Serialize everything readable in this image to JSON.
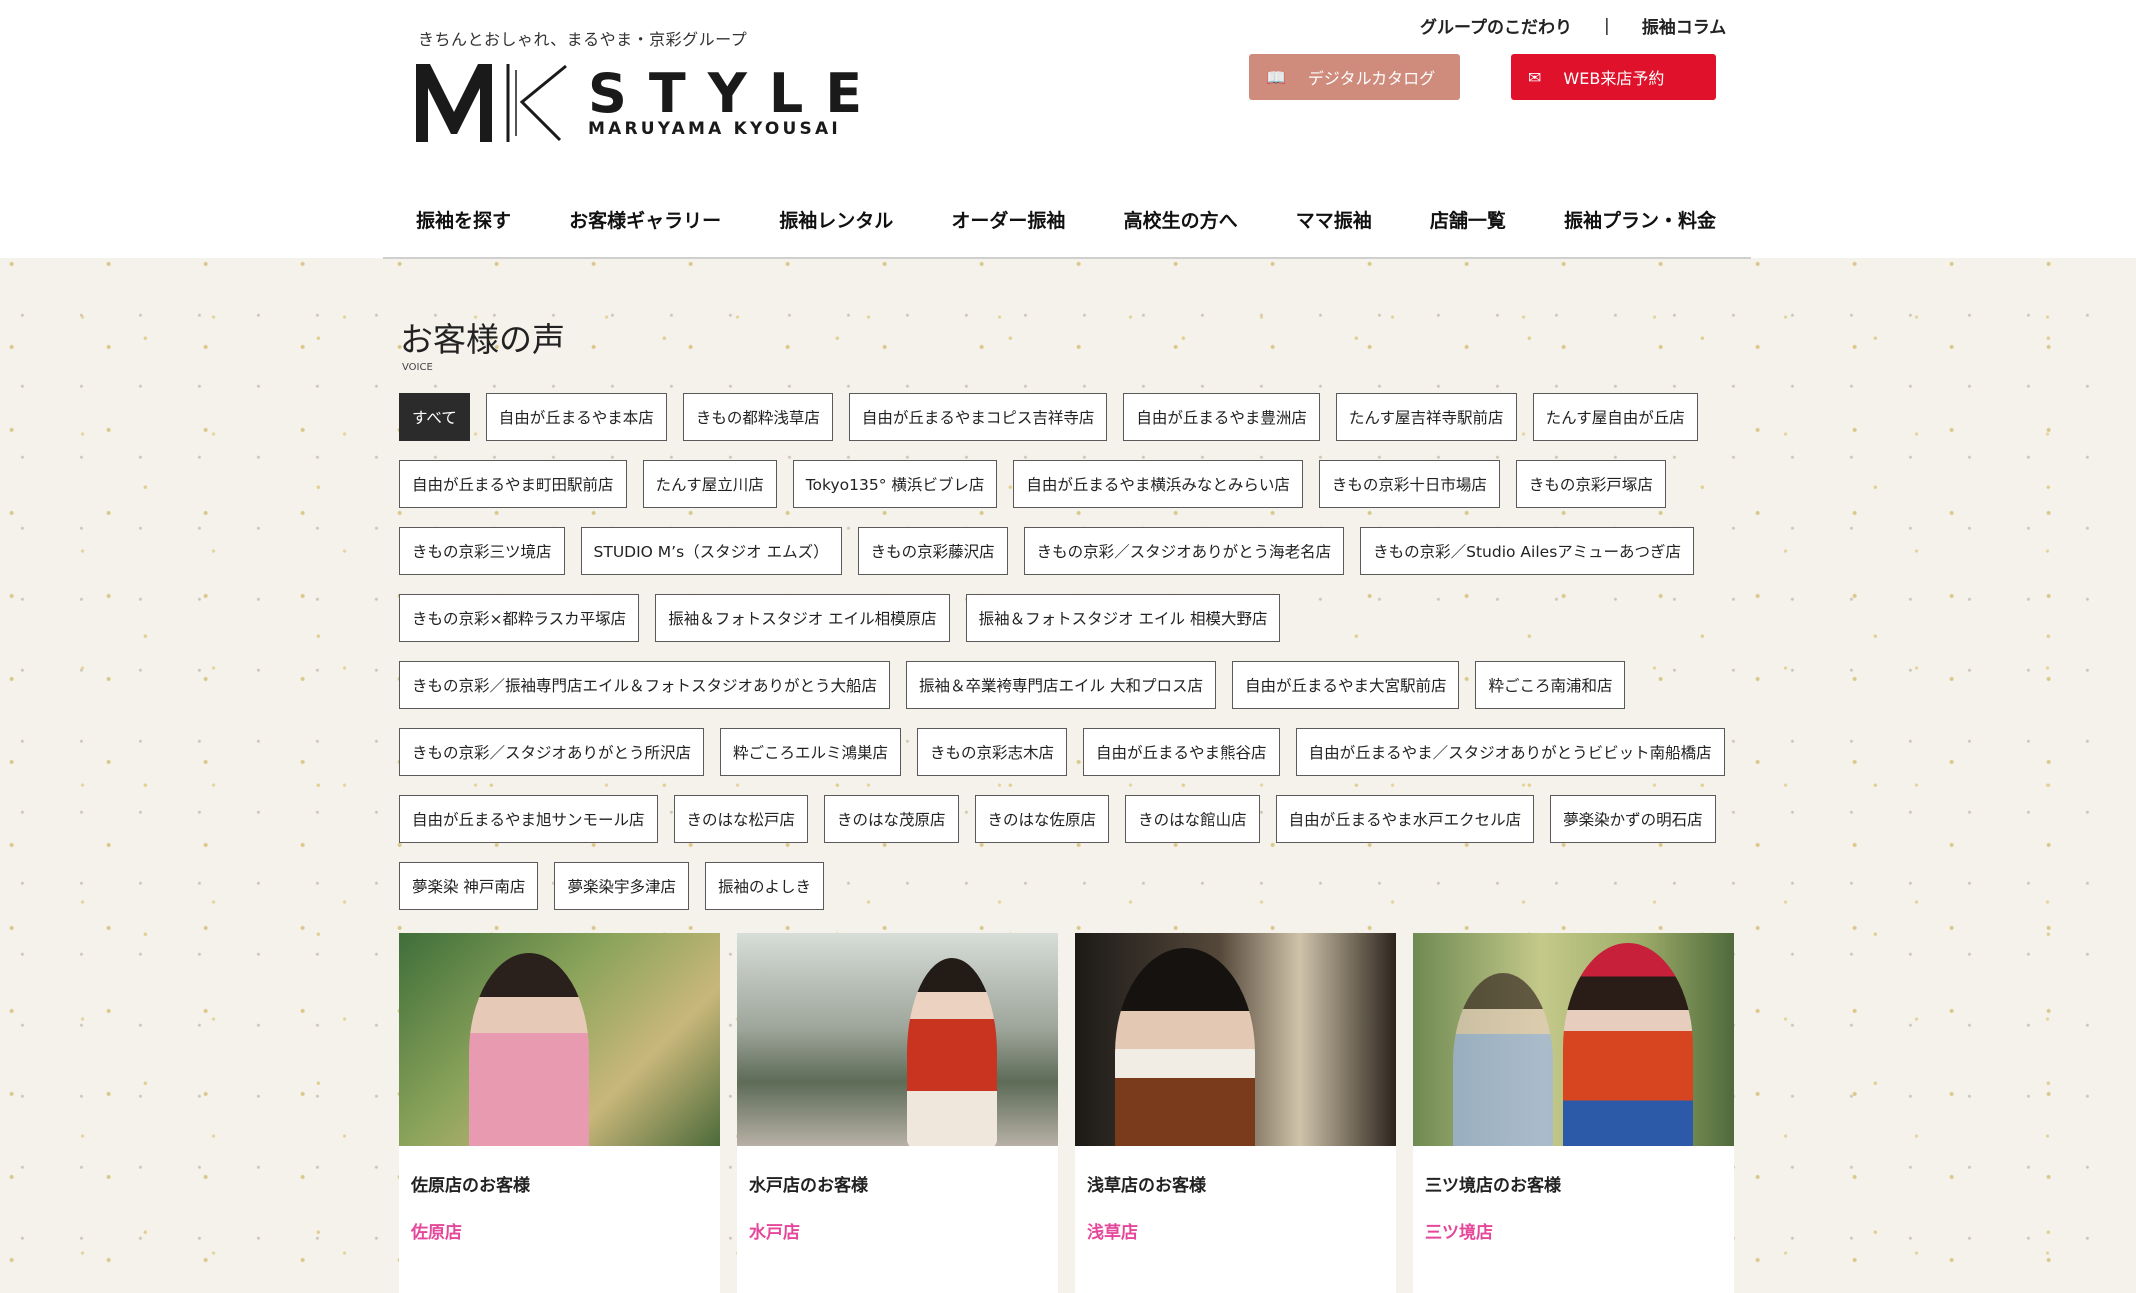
{
  "header": {
    "tagline": "きちんとおしゃれ、まるやま・京彩グループ",
    "logo_main": "STYLE",
    "logo_sub": "MARUYAMA KYOUSAI",
    "top_links": [
      "グループのこだわり",
      "振袖コラム"
    ],
    "top_link_separator": "|",
    "catalog_button": "デジタルカタログ",
    "reserve_button": "WEB来店予約",
    "catalog_color": "#cf8c7d",
    "reserve_color": "#e0112a"
  },
  "nav": [
    "振袖を探す",
    "お客様ギャラリー",
    "振袖レンタル",
    "オーダー振袖",
    "高校生の方へ",
    "ママ振袖",
    "店舗一覧",
    "振袖プラン・料金"
  ],
  "section": {
    "title": "お客様の声",
    "subtitle": "VOICE"
  },
  "tags": [
    "すべて",
    "自由が丘まるやま本店",
    "きもの都粋浅草店",
    "自由が丘まるやまコピス吉祥寺店",
    "自由が丘まるやま豊洲店",
    "たんす屋吉祥寺駅前店",
    "たんす屋自由が丘店",
    "自由が丘まるやま町田駅前店",
    "たんす屋立川店",
    "Tokyo135° 横浜ビブレ店",
    "自由が丘まるやま横浜みなとみらい店",
    "きもの京彩十日市場店",
    "きもの京彩戸塚店",
    "きもの京彩三ツ境店",
    "STUDIO M’s（スタジオ エムズ）",
    "きもの京彩藤沢店",
    "きもの京彩／スタジオありがとう海老名店",
    "きもの京彩／Studio Ailesアミューあつぎ店",
    "きもの京彩×都粋ラスカ平塚店",
    "振袖＆フォトスタジオ エイル相模原店",
    "振袖＆フォトスタジオ エイル 相模大野店",
    "きもの京彩／振袖専門店エイル＆フォトスタジオありがとう大船店",
    "振袖＆卒業袴専門店エイル 大和プロス店",
    "自由が丘まるやま大宮駅前店",
    "粋ごころ南浦和店",
    "きもの京彩／スタジオありがとう所沢店",
    "粋ごころエルミ鴻巣店",
    "きもの京彩志木店",
    "自由が丘まるやま熊谷店",
    "自由が丘まるやま／スタジオありがとうビビット南船橋店",
    "自由が丘まるやま旭サンモール店",
    "きのはな松戸店",
    "きのはな茂原店",
    "きのはな佐原店",
    "きのはな館山店",
    "自由が丘まるやま水戸エクセル店",
    "夢楽染かずの明石店",
    "夢楽染 神戸南店",
    "夢楽染宇多津店",
    "振袖のよしき"
  ],
  "cards": [
    {
      "title": "佐原店のお客様",
      "shop": "佐原店"
    },
    {
      "title": "水戸店のお客様",
      "shop": "水戸店"
    },
    {
      "title": "浅草店のお客様",
      "shop": "浅草店"
    },
    {
      "title": "三ツ境店のお客様",
      "shop": "三ツ境店"
    }
  ],
  "accent_pink": "#e5479a"
}
